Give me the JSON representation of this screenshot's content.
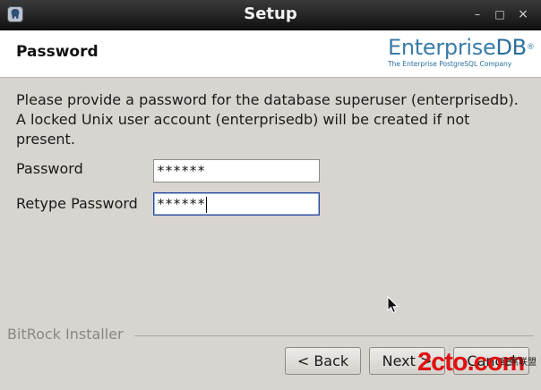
{
  "window": {
    "title": "Setup",
    "controls": [
      "–",
      "□",
      "×"
    ]
  },
  "header": {
    "page_title": "Password",
    "logo_text": "Enterprise",
    "logo_db": "DB",
    "logo_reg": "®",
    "logo_tagline": "The Enterprise PostgreSQL Company"
  },
  "main": {
    "description": "Please provide a password for the database superuser (enterprisedb). A locked Unix user account (enterprisedb) will be created if not present.",
    "password_label": "Password",
    "password_value": "******",
    "retype_label": "Retype Password",
    "retype_value": "******"
  },
  "footer": {
    "installer_label": "BitRock Installer",
    "back_label": "< Back",
    "next_label": "Next >",
    "cancel_label": "Cancel"
  },
  "overlay": {
    "watermark": "2cto.com",
    "watermark_sub": "红黑联盟"
  },
  "colors": {
    "accent": "#3a7ca8",
    "dialog_bg": "#d8d5d0",
    "focus_border": "#2a4a9a",
    "watermark_red": "#e01010"
  }
}
